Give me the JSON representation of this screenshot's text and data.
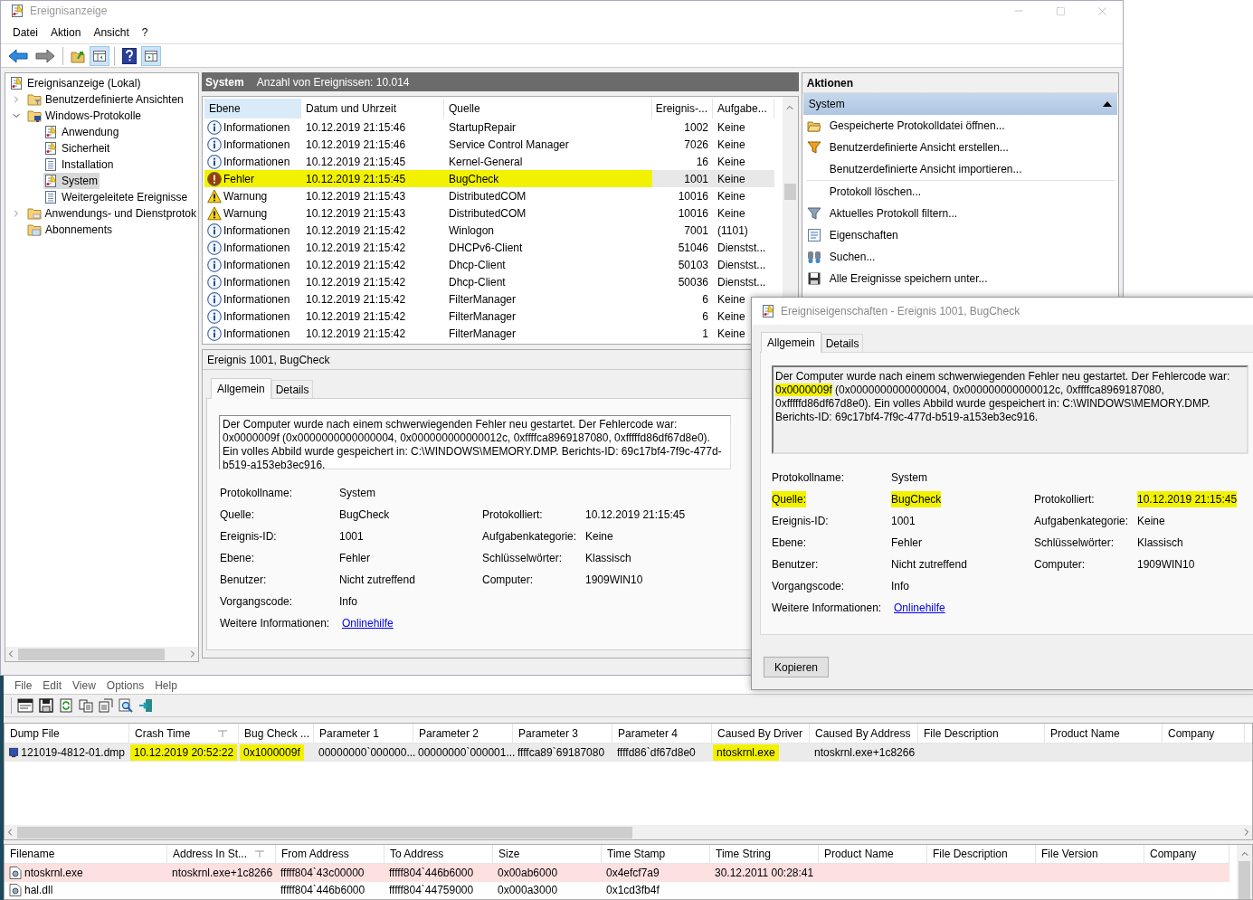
{
  "window": {
    "title": "Ereignisanzeige"
  },
  "menu": [
    "Datei",
    "Aktion",
    "Ansicht",
    "?"
  ],
  "toolbar": [
    [
      {
        "kind": "back",
        "pressed": false
      },
      {
        "kind": "forward",
        "pressed": false
      }
    ],
    [
      {
        "kind": "folder-up",
        "pressed": false
      },
      {
        "kind": "tree-toggle",
        "pressed": true
      }
    ],
    [
      {
        "kind": "help",
        "pressed": false
      },
      {
        "kind": "pane-toggle",
        "pressed": true
      }
    ]
  ],
  "tree": {
    "label": "Ereignisanzeige (Lokal)",
    "kind": "viewer",
    "children": [
      {
        "label": "Benutzerdefinierte Ansichten",
        "kind": "folder-filter",
        "expanded": false,
        "selected": false
      },
      {
        "label": "Windows-Protokolle",
        "kind": "folder-computer",
        "expanded": true,
        "selected": false,
        "children": [
          {
            "label": "Anwendung",
            "kind": "log-alert",
            "selected": false
          },
          {
            "label": "Sicherheit",
            "kind": "log-alert",
            "selected": false
          },
          {
            "label": "Installation",
            "kind": "log",
            "selected": false
          },
          {
            "label": "System",
            "kind": "log-alert",
            "selected": true
          },
          {
            "label": "Weitergeleitete Ereignisse",
            "kind": "log",
            "selected": false
          }
        ]
      },
      {
        "label": "Anwendungs- und Dienstprotok",
        "kind": "folder",
        "expanded": false,
        "selected": false
      },
      {
        "label": "Abonnements",
        "kind": "subscriptions",
        "selected": false
      }
    ]
  },
  "log_header": {
    "title": "System",
    "count": "Anzahl von Ereignissen: 10.014"
  },
  "events": {
    "columns": [
      {
        "label": "Ebene",
        "hover": true
      },
      {
        "label": "Datum und Uhrzeit",
        "hover": false
      },
      {
        "label": "Quelle",
        "hover": false
      },
      {
        "label": "Ereignis-...",
        "hover": false
      },
      {
        "label": "Aufgabe...",
        "hover": false
      }
    ],
    "rows": [
      {
        "kind": "info",
        "severity": "Informationen",
        "date": "10.12.2019 21:15:46",
        "source": "StartupRepair",
        "event_id": "1002",
        "task": "Keine",
        "selected": false,
        "highlighted": false
      },
      {
        "kind": "info",
        "severity": "Informationen",
        "date": "10.12.2019 21:15:46",
        "source": "Service Control Manager",
        "event_id": "7026",
        "task": "Keine",
        "selected": false,
        "highlighted": false
      },
      {
        "kind": "info",
        "severity": "Informationen",
        "date": "10.12.2019 21:15:45",
        "source": "Kernel-General",
        "event_id": "16",
        "task": "Keine",
        "selected": false,
        "highlighted": false
      },
      {
        "kind": "error",
        "severity": "Fehler",
        "date": "10.12.2019 21:15:45",
        "source": "BugCheck",
        "event_id": "1001",
        "task": "Keine",
        "selected": true,
        "highlighted": true
      },
      {
        "kind": "warning",
        "severity": "Warnung",
        "date": "10.12.2019 21:15:43",
        "source": "DistributedCOM",
        "event_id": "10016",
        "task": "Keine",
        "selected": false,
        "highlighted": false
      },
      {
        "kind": "warning",
        "severity": "Warnung",
        "date": "10.12.2019 21:15:43",
        "source": "DistributedCOM",
        "event_id": "10016",
        "task": "Keine",
        "selected": false,
        "highlighted": false
      },
      {
        "kind": "info",
        "severity": "Informationen",
        "date": "10.12.2019 21:15:42",
        "source": "Winlogon",
        "event_id": "7001",
        "task": "(1101)",
        "selected": false,
        "highlighted": false
      },
      {
        "kind": "info",
        "severity": "Informationen",
        "date": "10.12.2019 21:15:42",
        "source": "DHCPv6-Client",
        "event_id": "51046",
        "task": "Dienstst...",
        "selected": false,
        "highlighted": false
      },
      {
        "kind": "info",
        "severity": "Informationen",
        "date": "10.12.2019 21:15:42",
        "source": "Dhcp-Client",
        "event_id": "50103",
        "task": "Dienstst...",
        "selected": false,
        "highlighted": false
      },
      {
        "kind": "info",
        "severity": "Informationen",
        "date": "10.12.2019 21:15:42",
        "source": "Dhcp-Client",
        "event_id": "50036",
        "task": "Dienstst...",
        "selected": false,
        "highlighted": false
      },
      {
        "kind": "info",
        "severity": "Informationen",
        "date": "10.12.2019 21:15:42",
        "source": "FilterManager",
        "event_id": "6",
        "task": "Keine",
        "selected": false,
        "highlighted": false
      },
      {
        "kind": "info",
        "severity": "Informationen",
        "date": "10.12.2019 21:15:42",
        "source": "FilterManager",
        "event_id": "6",
        "task": "Keine",
        "selected": false,
        "highlighted": false
      },
      {
        "kind": "info",
        "severity": "Informationen",
        "date": "10.12.2019 21:15:42",
        "source": "FilterManager",
        "event_id": "1",
        "task": "Keine",
        "selected": false,
        "highlighted": false
      }
    ]
  },
  "preview": {
    "title": "Ereignis 1001, BugCheck",
    "tabs": [
      {
        "label": "Allgemein",
        "selected": true
      },
      {
        "label": "Details",
        "selected": false
      }
    ],
    "message": [
      {
        "text": "Der Computer wurde nach einem schwerwiegenden Fehler neu gestartet. Der Fehlercode war: 0x0000009f (0x0000000000000004, 0x000000000000012c, 0xffffca8969187080, 0xfffffd86df67d8e0). Ein volles Abbild wurde gespeichert in: C:\\WINDOWS\\MEMORY.DMP. Berichts-ID: 69c17bf4-7f9c-477d-b519-a153eb3ec916.",
        "highlighted": false
      }
    ],
    "fields": [
      {
        "left": {
          "label": "Protokollname:",
          "value": "System",
          "link": false
        }
      },
      {
        "left": {
          "label": "Quelle:",
          "value": "BugCheck",
          "link": false
        },
        "right": {
          "label": "Protokolliert:",
          "value": "10.12.2019 21:15:45",
          "link": false
        }
      },
      {
        "left": {
          "label": "Ereignis-ID:",
          "value": "1001",
          "link": false
        },
        "right": {
          "label": "Aufgabenkategorie:",
          "value": "Keine",
          "link": false
        }
      },
      {
        "left": {
          "label": "Ebene:",
          "value": "Fehler",
          "link": false
        },
        "right": {
          "label": "Schlüsselwörter:",
          "value": "Klassisch",
          "link": false
        }
      },
      {
        "left": {
          "label": "Benutzer:",
          "value": "Nicht zutreffend",
          "link": false
        },
        "right": {
          "label": "Computer:",
          "value": "1909WIN10",
          "link": false
        }
      },
      {
        "left": {
          "label": "Vorgangscode:",
          "value": "Info",
          "link": false
        }
      },
      {
        "left": {
          "label": "Weitere Informationen:",
          "value": "Onlinehilfe",
          "link": true
        }
      }
    ]
  },
  "actions": {
    "title": "Aktionen",
    "section": {
      "label": "System",
      "expanded": true
    },
    "groups": [
      [
        {
          "label": "Gespeicherte Protokolldatei öffnen...",
          "kind": "folder"
        },
        {
          "label": "Benutzerdefinierte Ansicht erstellen...",
          "kind": "filter-color"
        },
        {
          "label": "Benutzerdefinierte Ansicht importieren...",
          "kind": "plain"
        }
      ],
      [
        {
          "label": "Protokoll löschen...",
          "kind": "plain"
        },
        {
          "label": "Aktuelles Protokoll filtern...",
          "kind": "filter"
        },
        {
          "label": "Eigenschaften",
          "kind": "properties"
        },
        {
          "label": "Suchen...",
          "kind": "binoculars"
        },
        {
          "label": "Alle Ereignisse speichern unter...",
          "kind": "save"
        }
      ]
    ]
  },
  "dialog": {
    "title": "Ereigniseigenschaften - Ereignis 1001, BugCheck",
    "tabs": [
      {
        "label": "Allgemein",
        "selected": true
      },
      {
        "label": "Details",
        "selected": false
      }
    ],
    "message": [
      {
        "text": "Der Computer wurde nach einem schwerwiegenden Fehler neu gestartet. Der Fehlercode war: ",
        "highlighted": false
      },
      {
        "text": "0x0000009f",
        "highlighted": true
      },
      {
        "text": " (0x0000000000000004, 0x000000000000012c, 0xffffca8969187080, 0xfffffd86df67d8e0). Ein volles Abbild wurde gespeichert in: C:\\WINDOWS\\MEMORY.DMP. Berichts-ID: 69c17bf4-7f9c-477d-b519-a153eb3ec916.",
        "highlighted": false
      }
    ],
    "fields": [
      {
        "left": {
          "label": "Protokollname:",
          "value": "System",
          "link": false,
          "label_highlighted": false,
          "value_highlighted": false
        }
      },
      {
        "left": {
          "label": "Quelle:",
          "value": "BugCheck",
          "link": false,
          "label_highlighted": true,
          "value_highlighted": true
        },
        "right": {
          "label": "Protokolliert:",
          "value": "10.12.2019 21:15:45",
          "link": false,
          "label_highlighted": false,
          "value_highlighted": true
        }
      },
      {
        "left": {
          "label": "Ereignis-ID:",
          "value": "1001",
          "link": false,
          "label_highlighted": false,
          "value_highlighted": false
        },
        "right": {
          "label": "Aufgabenkategorie:",
          "value": "Keine",
          "link": false,
          "label_highlighted": false,
          "value_highlighted": false
        }
      },
      {
        "left": {
          "label": "Ebene:",
          "value": "Fehler",
          "link": false,
          "label_highlighted": false,
          "value_highlighted": false
        },
        "right": {
          "label": "Schlüsselwörter:",
          "value": "Klassisch",
          "link": false,
          "label_highlighted": false,
          "value_highlighted": false
        }
      },
      {
        "left": {
          "label": "Benutzer:",
          "value": "Nicht zutreffend",
          "link": false,
          "label_highlighted": false,
          "value_highlighted": false
        },
        "right": {
          "label": "Computer:",
          "value": "1909WIN10",
          "link": false,
          "label_highlighted": false,
          "value_highlighted": false
        }
      },
      {
        "left": {
          "label": "Vorgangscode:",
          "value": "Info",
          "link": false,
          "label_highlighted": false,
          "value_highlighted": false
        }
      },
      {
        "left": {
          "label": "Weitere Informationen:",
          "value": "Onlinehilfe",
          "link": true,
          "label_highlighted": false,
          "value_highlighted": false
        }
      }
    ],
    "buttons": [
      "Kopieren"
    ]
  },
  "bluescreen": {
    "menu": [
      "File",
      "Edit",
      "View",
      "Options",
      "Help"
    ],
    "toolbar": [
      {
        "kind": "properties"
      },
      {
        "kind": "save"
      },
      {
        "kind": "refresh"
      },
      {
        "kind": "copy"
      },
      {
        "kind": "report"
      },
      {
        "kind": "find"
      },
      {
        "kind": "exit"
      }
    ],
    "crashes": {
      "columns": [
        {
          "label": "Dump File",
          "sorted": false
        },
        {
          "label": "Crash Time",
          "sorted": true
        },
        {
          "label": "Bug Check ...",
          "sorted": false
        },
        {
          "label": "Parameter 1",
          "sorted": false
        },
        {
          "label": "Parameter 2",
          "sorted": false
        },
        {
          "label": "Parameter 3",
          "sorted": false
        },
        {
          "label": "Parameter 4",
          "sorted": false
        },
        {
          "label": "Caused By Driver",
          "sorted": false
        },
        {
          "label": "Caused By Address",
          "sorted": false
        },
        {
          "label": "File Description",
          "sorted": false
        },
        {
          "label": "Product Name",
          "sorted": false
        },
        {
          "label": "Company",
          "sorted": false
        }
      ],
      "rows": [
        {
          "selected": true,
          "dump_file": {
            "text": "121019-4812-01.dmp",
            "highlighted": false
          },
          "crash_time": {
            "text": "10.12.2019 20:52:22",
            "highlighted": true
          },
          "bug_check": {
            "text": "0x1000009f",
            "highlighted": true
          },
          "parameter_1": {
            "text": "00000000`000000...",
            "highlighted": false
          },
          "parameter_2": {
            "text": "00000000`000001...",
            "highlighted": false
          },
          "parameter_3": {
            "text": "ffffca89`69187080",
            "highlighted": false
          },
          "parameter_4": {
            "text": "ffffd86`df67d8e0",
            "highlighted": false
          },
          "caused_by_driver": {
            "text": "ntoskrnl.exe",
            "highlighted": true
          },
          "caused_by_address": {
            "text": "ntoskrnl.exe+1c8266",
            "highlighted": false
          }
        }
      ]
    },
    "modules": {
      "columns": [
        {
          "label": "Filename",
          "sorted": false
        },
        {
          "label": "Address In St...",
          "sorted": true
        },
        {
          "label": "From Address",
          "sorted": false
        },
        {
          "label": "To Address",
          "sorted": false
        },
        {
          "label": "Size",
          "sorted": false
        },
        {
          "label": "Time Stamp",
          "sorted": false
        },
        {
          "label": "Time String",
          "sorted": false
        },
        {
          "label": "Product Name",
          "sorted": false
        },
        {
          "label": "File Description",
          "sorted": false
        },
        {
          "label": "File Version",
          "sorted": false
        },
        {
          "label": "Company",
          "sorted": false
        }
      ],
      "rows": [
        {
          "marked": true,
          "filename": "ntoskrnl.exe",
          "address_in_stack": "ntoskrnl.exe+1c8266",
          "from_address": "fffff804`43c00000",
          "to_address": "fffff804`446b6000",
          "size": "0x00ab6000",
          "time_stamp": "0x4efcf7a9",
          "time_string": "30.12.2011 00:28:41"
        },
        {
          "marked": false,
          "filename": "hal.dll",
          "from_address": "fffff804`446b6000",
          "to_address": "fffff804`44759000",
          "size": "0x000a3000",
          "time_stamp": "0x1cd3fb4f"
        }
      ]
    }
  }
}
